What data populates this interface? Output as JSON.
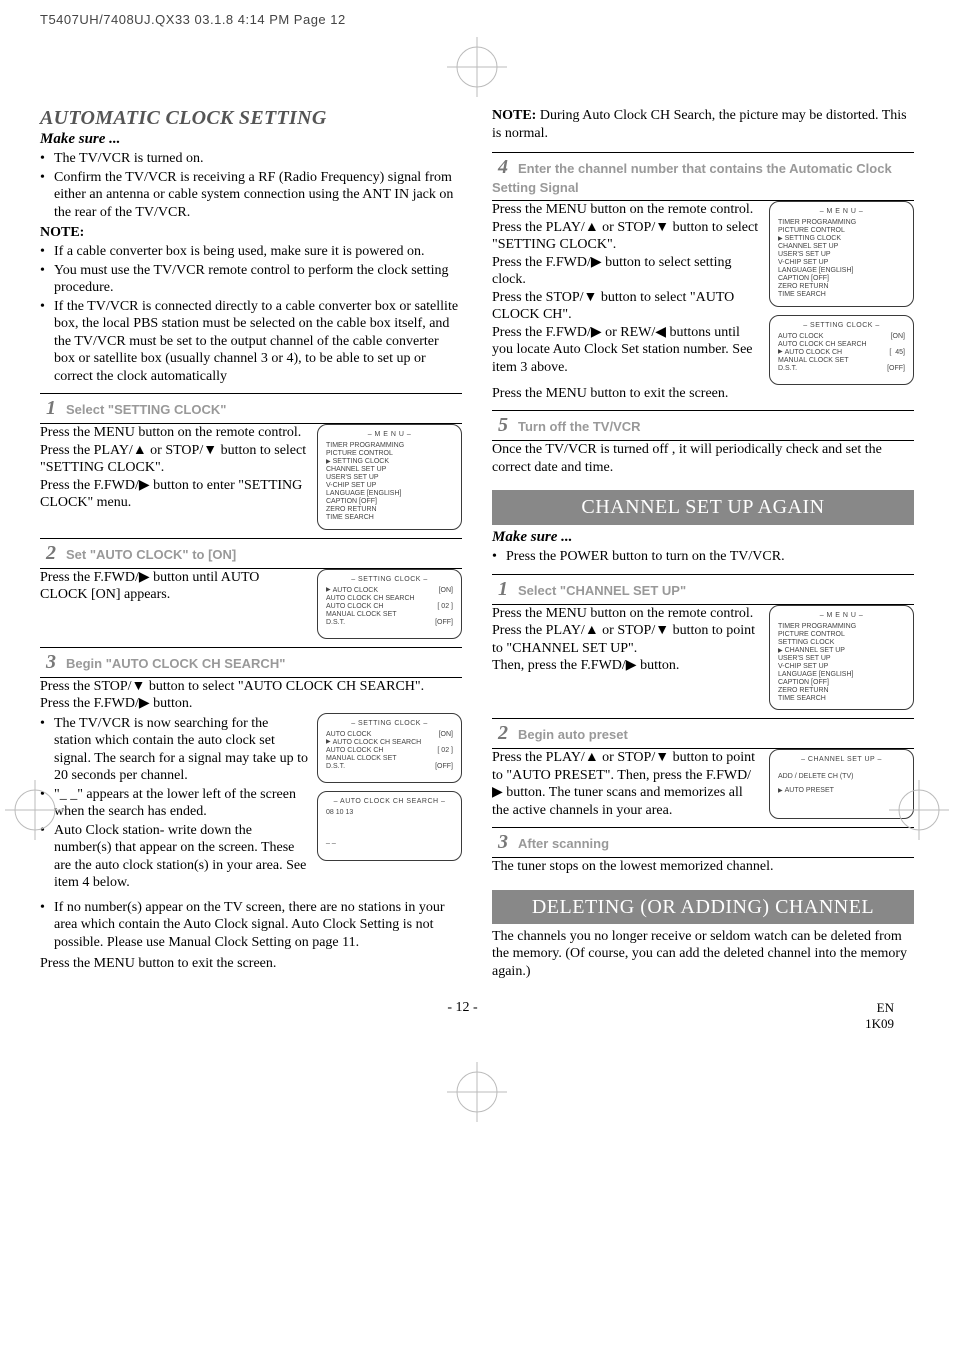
{
  "header": "T5407UH/7408UJ.QX33  03.1.8  4:14 PM  Page 12",
  "left": {
    "title": "AUTOMATIC CLOCK SETTING",
    "makesure": "Make sure ...",
    "pre_bullets": [
      "The TV/VCR is turned on.",
      "Confirm the TV/VCR is receiving a RF (Radio Frequency) signal from either an antenna or cable system connection using the ANT IN jack on the rear of the TV/VCR."
    ],
    "note_hd": "NOTE:",
    "note_bullets": [
      "If a cable converter box is being used, make sure it is powered on.",
      "You must use the TV/VCR remote control to perform the clock setting procedure.",
      "If the TV/VCR is connected directly to a cable converter box or satellite box, the local PBS station must be selected on the cable box itself, and the TV/VCR must be set to the output channel of the cable converter box or satellite box (usually channel 3 or 4), to be able to set up or correct the clock automatically"
    ],
    "step1": {
      "num": "1",
      "label": "Select \"SETTING CLOCK\"",
      "body": "Press the MENU button on the remote control.\nPress the PLAY/▲ or STOP/▼ button to select \"SETTING CLOCK\".\nPress the F.FWD/▶ button to enter \"SETTING CLOCK\" menu."
    },
    "osd_menu_title": "– M E N U –",
    "osd_menu_items": [
      "TIMER PROGRAMMING",
      "PICTURE CONTROL",
      "SETTING CLOCK",
      "CHANNEL SET UP",
      "USER'S SET UP",
      "V-CHIP SET UP",
      "LANGUAGE  [ENGLISH]",
      "CAPTION  [OFF]",
      "ZERO RETURN",
      "TIME SEARCH"
    ],
    "step2": {
      "num": "2",
      "label": "Set \"AUTO CLOCK\" to [ON]",
      "body": "Press the F.FWD/▶ button until AUTO CLOCK [ON] appears."
    },
    "osd_setting_title": "– SETTING CLOCK –",
    "osd_setting_items": [
      {
        "label": "AUTO CLOCK",
        "val": "[ON]"
      },
      {
        "label": "AUTO CLOCK CH SEARCH",
        "val": ""
      },
      {
        "label": "AUTO CLOCK CH",
        "val": "[ 02 ]"
      },
      {
        "label": "MANUAL CLOCK SET",
        "val": ""
      },
      {
        "label": "D.S.T.",
        "val": "[OFF]"
      }
    ],
    "step3": {
      "num": "3",
      "label": "Begin \"AUTO CLOCK CH SEARCH\"",
      "body1": "Press the STOP/▼ button to select \"AUTO CLOCK CH SEARCH\".",
      "body2": "Press the F.FWD/▶ button.",
      "bullets": [
        "The TV/VCR is now searching for the station which contain the auto clock set signal. The search for a signal may take up to 20 seconds per channel.",
        "\"_ _\" appears at the lower left of the screen when the search has ended.",
        "Auto Clock station- write down the number(s) that appear on the screen. These are the auto clock station(s) in your area. See item 4 below.",
        "If no number(s) appear on the TV screen, there are no stations in your area which contain the Auto Clock signal. Auto Clock Setting is not possible. Please use Manual Clock Setting on page 11."
      ],
      "tail": "Press the MENU button to exit the screen."
    },
    "osd_search_title": "– AUTO CLOCK CH SEARCH –",
    "osd_search_items": [
      "08    10    13",
      "",
      "_ _"
    ]
  },
  "right": {
    "note": "NOTE: During Auto Clock CH Search, the picture may be distorted. This is normal.",
    "note_label": "NOTE:",
    "note_text": " During Auto Clock CH Search, the picture may be distorted. This is normal.",
    "step4": {
      "num": "4",
      "label": "Enter the channel number that contains the Automatic Clock Setting Signal",
      "body": "Press the MENU button on the remote control.\nPress the PLAY/▲ or STOP/▼ button to select \"SETTING CLOCK\".\nPress the F.FWD/▶ button to select setting clock.\nPress the STOP/▼ button to select \"AUTO CLOCK CH\".\nPress the F.FWD/▶ or REW/◀ buttons until you locate Auto Clock Set station number. See item 3 above.",
      "tail": "Press the MENU button to exit the screen."
    },
    "osd_setting2_items": [
      {
        "label": "AUTO CLOCK",
        "val": "[ON]"
      },
      {
        "label": "AUTO CLOCK CH SEARCH",
        "val": ""
      },
      {
        "label": "AUTO CLOCK CH",
        "val": "[  45]"
      },
      {
        "label": "MANUAL CLOCK SET",
        "val": ""
      },
      {
        "label": "D.S.T.",
        "val": "[OFF]"
      }
    ],
    "step5": {
      "num": "5",
      "label": "Turn off the TV/VCR",
      "body": "Once the TV/VCR is turned off , it will periodically check and set the correct date and time."
    },
    "box1": "CHANNEL SET UP AGAIN",
    "makesure2": "Make sure ...",
    "ms2bullet": "Press the POWER button to turn on the TV/VCR.",
    "cstep1": {
      "num": "1",
      "label": "Select \"CHANNEL SET UP\"",
      "body": "Press the MENU button on the remote control.\nPress the PLAY/▲ or STOP/▼ button to point to \"CHANNEL SET UP\".\nThen, press the F.FWD/▶ button."
    },
    "cstep2": {
      "num": "2",
      "label": "Begin auto preset",
      "body": "Press the PLAY/▲ or STOP/▼ button to point to \"AUTO PRESET\". Then, press the F.FWD/▶ button. The tuner scans and memorizes all the active channels in your area."
    },
    "osd_chset_title": "– CHANNEL SET UP –",
    "osd_chset_items": [
      "ADD / DELETE CH (TV)",
      "AUTO PRESET"
    ],
    "cstep3": {
      "num": "3",
      "label": "After scanning",
      "body": "The tuner stops on the lowest memorized channel."
    },
    "box2": "DELETING (OR ADDING) CHANNEL",
    "del_body": "The channels you no longer receive or seldom watch can be deleted from the memory. (Of course, you can add the deleted channel into the memory again.)"
  },
  "footer": {
    "page": "- 12 -",
    "en": "EN",
    "code": "1K09"
  }
}
